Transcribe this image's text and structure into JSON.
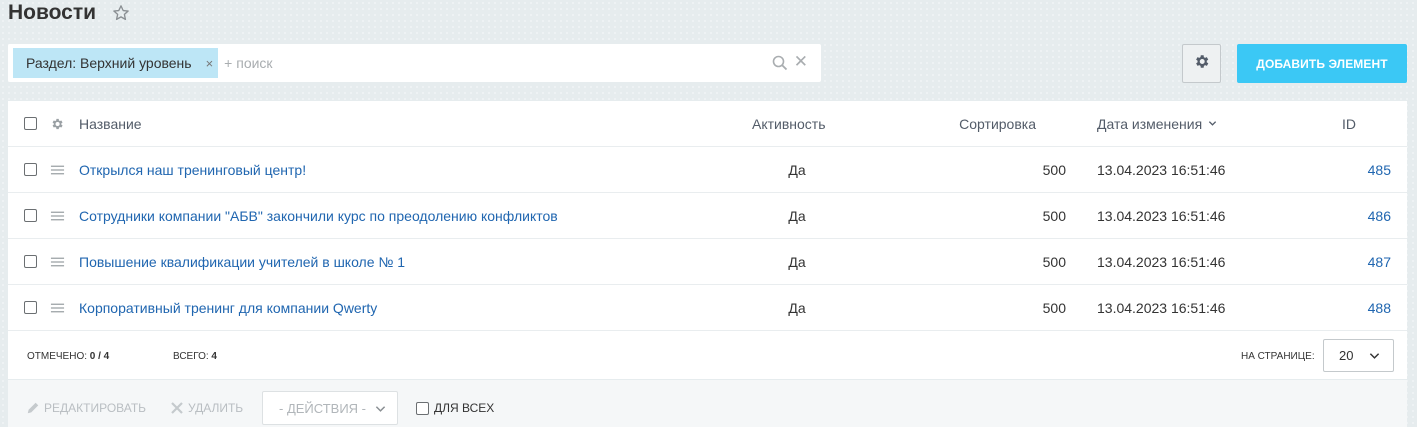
{
  "page": {
    "title": "Новости"
  },
  "filter": {
    "chip_label": "Раздел: Верхний уровень",
    "chip_close": "×",
    "search_placeholder": "+ поиск",
    "clear_symbol": "✕"
  },
  "toolbar": {
    "add_label": "ДОБАВИТЬ ЭЛЕМЕНТ"
  },
  "grid": {
    "columns": {
      "name": "Название",
      "active": "Активность",
      "sort": "Сортировка",
      "date": "Дата изменения",
      "id": "ID"
    },
    "rows": [
      {
        "name": "Открылся наш тренинговый центр!",
        "active": "Да",
        "sort": "500",
        "date": "13.04.2023 16:51:46",
        "id": "485"
      },
      {
        "name": "Сотрудники компании \"АБВ\" закончили курс по преодолению конфликтов",
        "active": "Да",
        "sort": "500",
        "date": "13.04.2023 16:51:46",
        "id": "486"
      },
      {
        "name": "Повышение квалификации учителей в школе № 1",
        "active": "Да",
        "sort": "500",
        "date": "13.04.2023 16:51:46",
        "id": "487"
      },
      {
        "name": "Корпоративный тренинг для компании Qwerty",
        "active": "Да",
        "sort": "500",
        "date": "13.04.2023 16:51:46",
        "id": "488"
      }
    ]
  },
  "footer": {
    "selected_label": "ОТМЕЧЕНО:",
    "selected_value": "0 / 4",
    "total_label": "ВСЕГО:",
    "total_value": "4",
    "per_page_label": "НА СТРАНИЦЕ:",
    "per_page_value": "20"
  },
  "actions": {
    "edit_label": "РЕДАКТИРОВАТЬ",
    "delete_label": "УДАЛИТЬ",
    "actions_placeholder": "- ДЕЙСТВИЯ -",
    "for_all_label": "ДЛЯ ВСЕХ"
  },
  "colors": {
    "accent": "#3bc8f5",
    "link": "#2066b0",
    "chip": "#bde6f6",
    "background": "#e6ecee"
  },
  "icons": [
    "star-icon",
    "search-icon",
    "clear-icon",
    "gear-icon",
    "drag-handle-icon",
    "chevron-down-icon",
    "pencil-icon",
    "close-icon"
  ]
}
